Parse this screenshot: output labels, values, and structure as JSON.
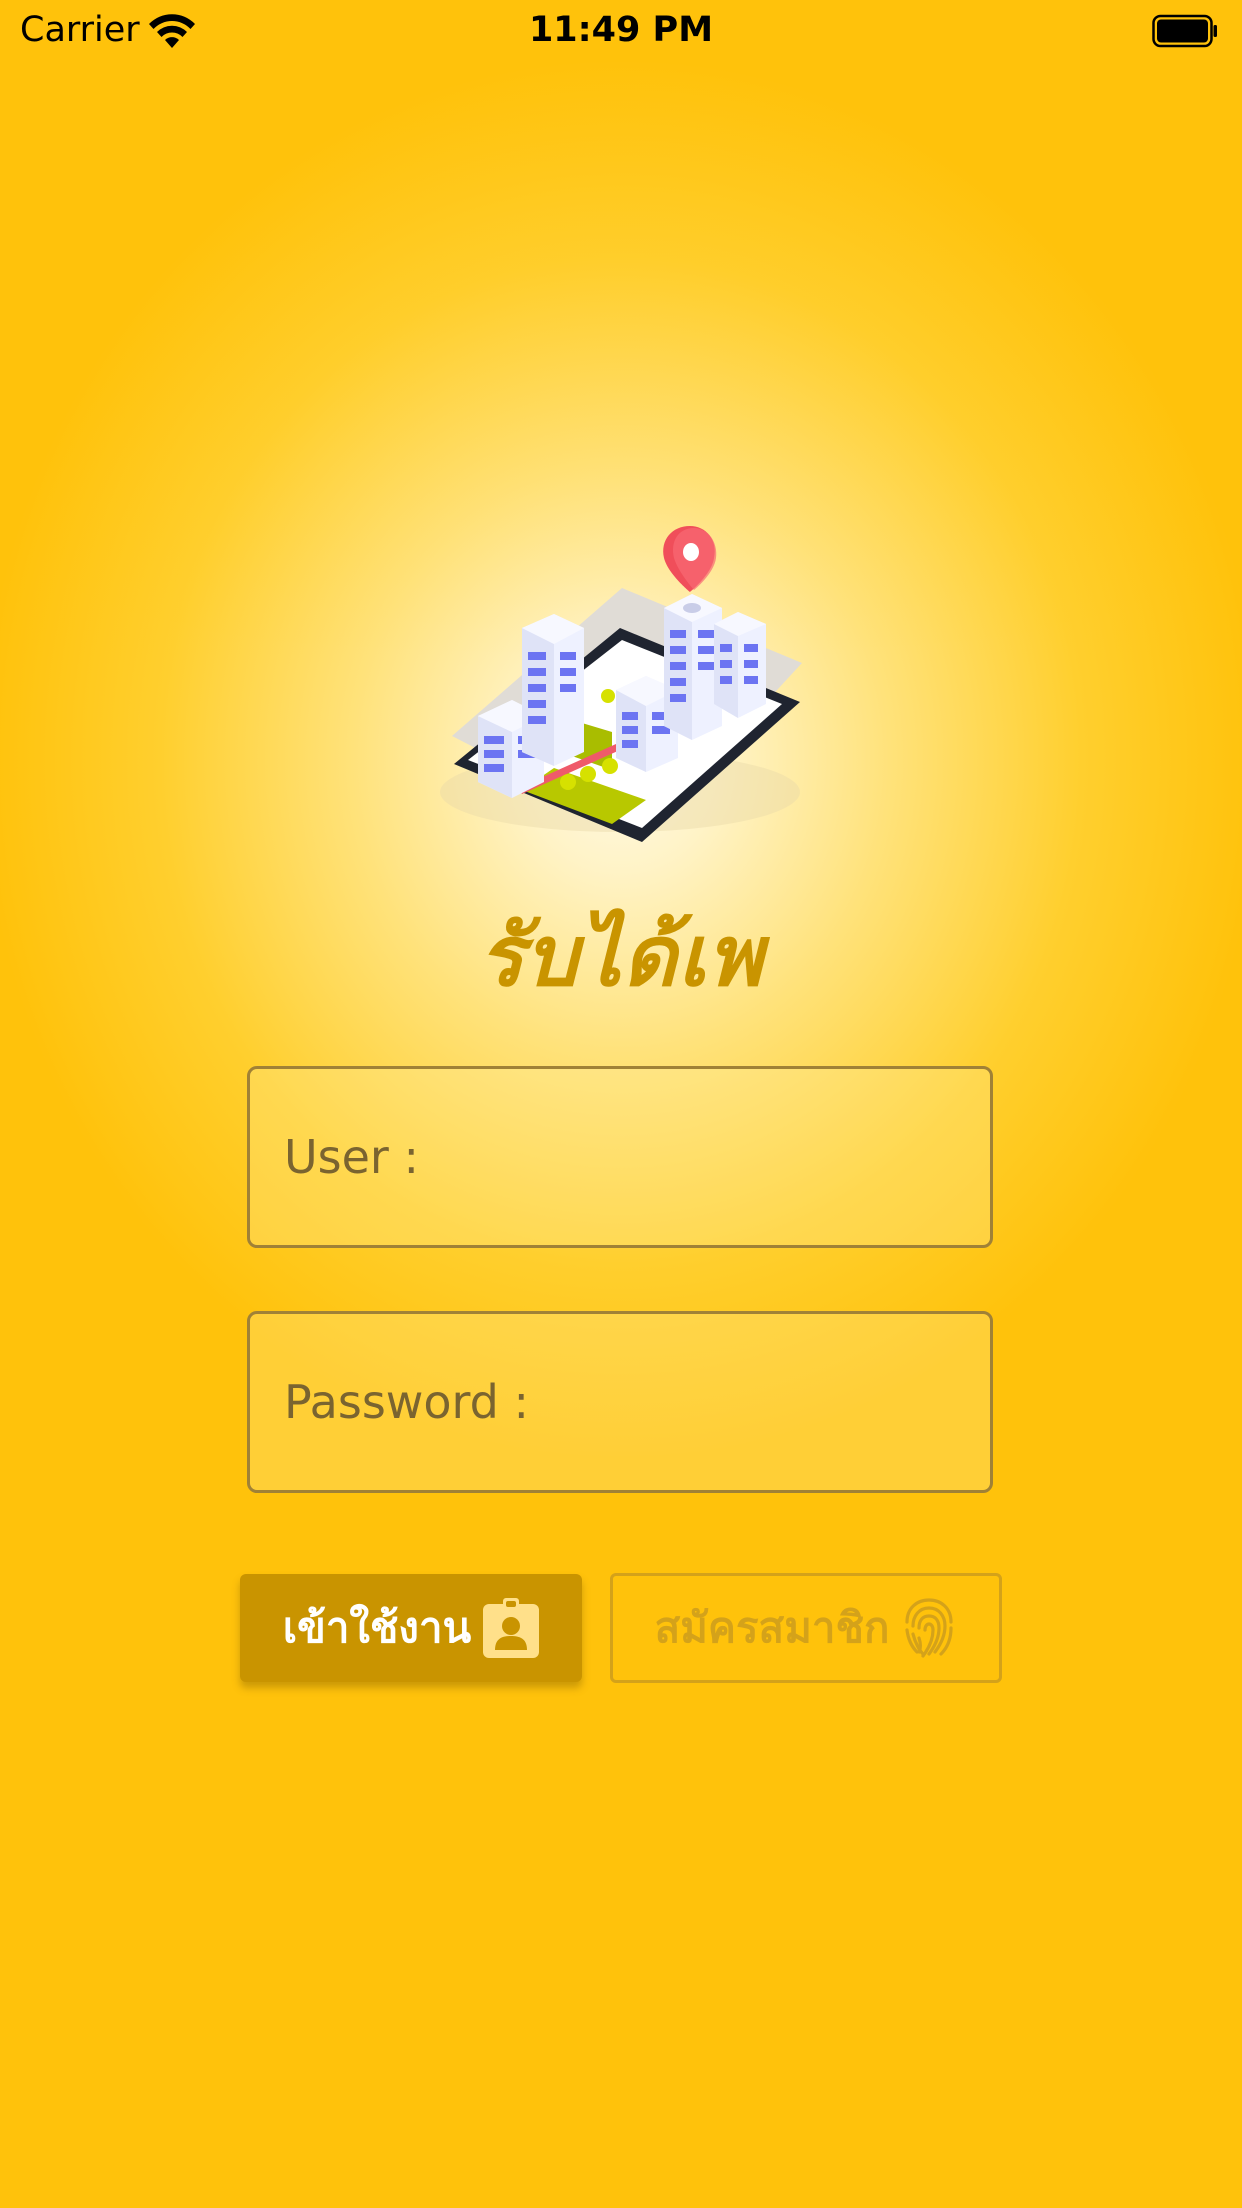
{
  "status_bar": {
    "carrier": "Carrier",
    "time": "11:49 PM",
    "wifi_icon": "wifi-icon",
    "battery_icon": "battery-full-icon"
  },
  "app": {
    "title": "รับได้เพ",
    "logo_icon": "city-phone-map-pin-illustration"
  },
  "form": {
    "user_placeholder": "User :",
    "user_value": "",
    "password_placeholder": "Password :",
    "password_value": ""
  },
  "buttons": {
    "login_label": "เข้าใช้งาน",
    "login_icon": "id-badge-icon",
    "register_label": "สมัครสมาชิก",
    "register_icon": "fingerprint-icon"
  },
  "colors": {
    "background_top": "#ffc20b",
    "background_center": "#fffaea",
    "accent_gold": "#c99400",
    "field_border": "#a08136",
    "register_outline": "#d4a21a"
  }
}
